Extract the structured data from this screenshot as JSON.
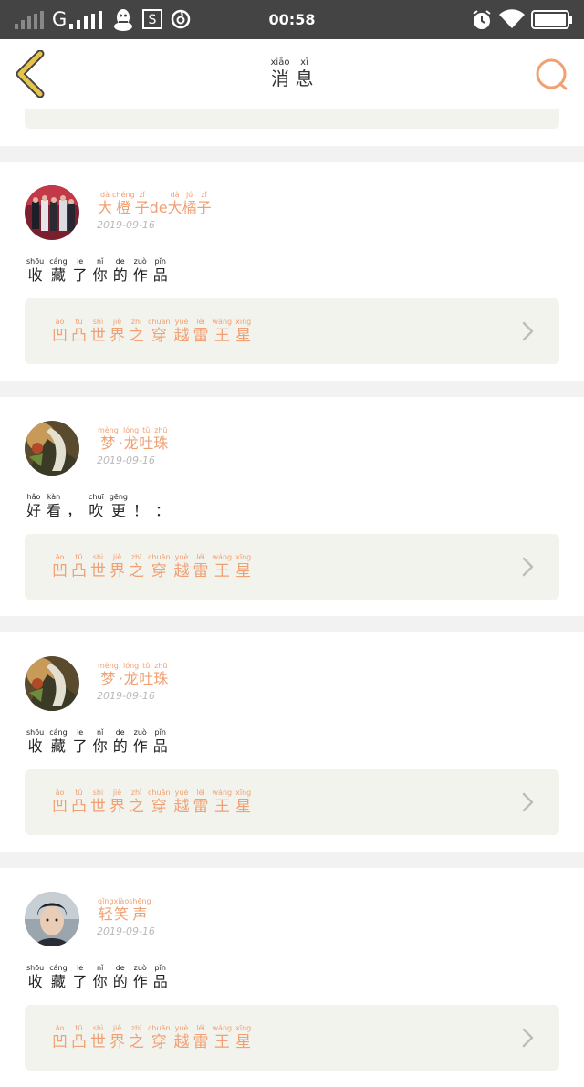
{
  "status_bar": {
    "carrier": "G",
    "time": "00:58",
    "icons": [
      "signal-icon",
      "signal-icon",
      "qq-icon",
      "s-app-icon",
      "netease-music-icon",
      "alarm-icon",
      "wifi-icon",
      "battery-icon"
    ]
  },
  "header": {
    "title": [
      {
        "hz": "消",
        "py": "xiāo"
      },
      {
        "hz": "息",
        "py": "xī"
      }
    ],
    "back_icon": "chevron-left-icon",
    "search_icon": "search-icon"
  },
  "colors": {
    "accent": "#f0a072",
    "back_icon": "#e8c34a",
    "work_box": "#f3f3ee",
    "status_bar": "#444444"
  },
  "work": {
    "title": [
      {
        "hz": "凹",
        "py": "āo"
      },
      {
        "hz": "凸",
        "py": "tū"
      },
      {
        "hz": "世",
        "py": "shì"
      },
      {
        "hz": "界",
        "py": "jiè"
      },
      {
        "hz": "之",
        "py": "zhī"
      },
      {
        "hz": "穿",
        "py": "chuān"
      },
      {
        "hz": "越",
        "py": "yuè"
      },
      {
        "hz": "雷",
        "py": "léi"
      },
      {
        "hz": "王",
        "py": "wáng"
      },
      {
        "hz": "星",
        "py": "xīng"
      }
    ]
  },
  "messages": [
    {
      "username": [
        {
          "hz": "大",
          "py": "dà"
        },
        {
          "hz": "橙",
          "py": "chéng"
        },
        {
          "hz": "子",
          "py": "zǐ"
        },
        {
          "plain": "de"
        },
        {
          "hz": "大",
          "py": "dà"
        },
        {
          "hz": "橘",
          "py": "jú"
        },
        {
          "hz": "子",
          "py": "zǐ"
        }
      ],
      "date": "2019-09-16",
      "text": [
        {
          "hz": "收",
          "py": "shōu"
        },
        {
          "hz": "藏",
          "py": "cáng"
        },
        {
          "hz": "了",
          "py": "le"
        },
        {
          "hz": "你",
          "py": "nǐ"
        },
        {
          "hz": "的",
          "py": "de"
        },
        {
          "hz": "作",
          "py": "zuò"
        },
        {
          "hz": "品",
          "py": "pǐn"
        }
      ],
      "avatar": "group-photo-avatar"
    },
    {
      "username": [
        {
          "hz": "梦",
          "py": "mèng"
        },
        {
          "plain": "·"
        },
        {
          "hz": "龙",
          "py": "lóng"
        },
        {
          "hz": "吐",
          "py": "tǔ"
        },
        {
          "hz": "珠",
          "py": "zhū"
        }
      ],
      "date": "2019-09-16",
      "text": [
        {
          "hz": "好",
          "py": "hǎo"
        },
        {
          "hz": "看",
          "py": "kàn"
        },
        {
          "plain": "，"
        },
        {
          "hz": "吹",
          "py": "chuī"
        },
        {
          "hz": "更",
          "py": "gēng"
        },
        {
          "plain": "！"
        },
        {
          "plain": "："
        }
      ],
      "avatar": "fantasy-art-avatar"
    },
    {
      "username": [
        {
          "hz": "梦",
          "py": "mèng"
        },
        {
          "plain": "·"
        },
        {
          "hz": "龙",
          "py": "lóng"
        },
        {
          "hz": "吐",
          "py": "tǔ"
        },
        {
          "hz": "珠",
          "py": "zhū"
        }
      ],
      "date": "2019-09-16",
      "text": [
        {
          "hz": "收",
          "py": "shōu"
        },
        {
          "hz": "藏",
          "py": "cáng"
        },
        {
          "hz": "了",
          "py": "le"
        },
        {
          "hz": "你",
          "py": "nǐ"
        },
        {
          "hz": "的",
          "py": "de"
        },
        {
          "hz": "作",
          "py": "zuò"
        },
        {
          "hz": "品",
          "py": "pǐn"
        }
      ],
      "avatar": "fantasy-art-avatar"
    },
    {
      "username": [
        {
          "hz": "轻",
          "py": "qīng"
        },
        {
          "hz": "笑",
          "py": "xiào"
        },
        {
          "hz": "声",
          "py": "shēng"
        }
      ],
      "date": "2019-09-16",
      "text": [
        {
          "hz": "收",
          "py": "shōu"
        },
        {
          "hz": "藏",
          "py": "cáng"
        },
        {
          "hz": "了",
          "py": "le"
        },
        {
          "hz": "你",
          "py": "nǐ"
        },
        {
          "hz": "的",
          "py": "de"
        },
        {
          "hz": "作",
          "py": "zuò"
        },
        {
          "hz": "品",
          "py": "pǐn"
        }
      ],
      "avatar": "portrait-avatar"
    }
  ]
}
